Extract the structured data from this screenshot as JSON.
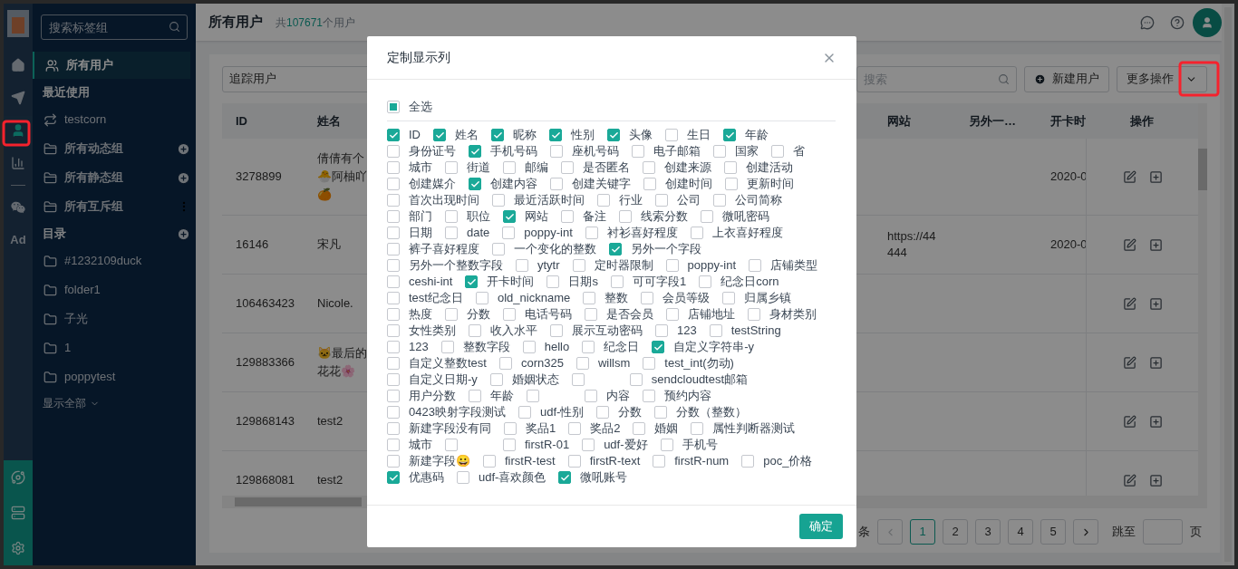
{
  "rail": {
    "nav": [
      {
        "kind": "home",
        "selected": false
      },
      {
        "kind": "send",
        "selected": false
      },
      {
        "kind": "user",
        "selected": true
      },
      {
        "kind": "chart",
        "selected": false
      }
    ],
    "nav_more": [
      {
        "kind": "wechat",
        "selected": false
      },
      {
        "kind": "text",
        "label": "Ad",
        "selected": false
      }
    ],
    "bottom": [
      {
        "kind": "network"
      },
      {
        "kind": "server"
      },
      {
        "kind": "settings"
      }
    ]
  },
  "sidebar": {
    "search_placeholder": "搜索标签组",
    "items": [
      {
        "kind": "all-users",
        "label": "所有用户",
        "selected": true
      },
      {
        "kind": "section",
        "label": "最近使用"
      },
      {
        "kind": "recent",
        "label": "testcorn",
        "selected": false
      },
      {
        "kind": "group",
        "label": "所有动态组",
        "add": true,
        "selected": false
      },
      {
        "kind": "group",
        "label": "所有静态组",
        "add": true,
        "selected": false
      },
      {
        "kind": "group",
        "label": "所有互斥组",
        "more": true,
        "selected": false
      },
      {
        "kind": "section",
        "label": "目录",
        "add": true
      },
      {
        "kind": "folder",
        "label": "#1232109duck",
        "selected": false
      },
      {
        "kind": "folder",
        "label": "folder1",
        "selected": false
      },
      {
        "kind": "folder",
        "label": "子光",
        "selected": false
      },
      {
        "kind": "folder",
        "label": "1",
        "selected": false
      },
      {
        "kind": "folder",
        "label": "poppytest",
        "selected": false
      }
    ],
    "show_all": "显示全部"
  },
  "header": {
    "title": "所有用户",
    "count_prefix": "共",
    "count": "107671",
    "count_suffix": "个用户"
  },
  "toolbar": {
    "segment_select": "追踪用户",
    "search_placeholder": "搜索",
    "new_button": "新建用户",
    "more_button": "更多操作"
  },
  "table": {
    "columns": [
      "ID",
      "姓名",
      "网站",
      "另外一…",
      "开卡时",
      "操作"
    ],
    "rows": [
      {
        "id": "3278899",
        "name": "倩倩有个🐣阿柚吖🍊",
        "card_time": "2020-0"
      },
      {
        "id": "16146",
        "name": "宋凡",
        "website": "https://44444",
        "card_time": "2020-0"
      },
      {
        "id": "106463423",
        "name": "Nicole."
      },
      {
        "id": "129883366",
        "name": "🐱最后的花花🌸"
      },
      {
        "id": "129868143",
        "name": "test2"
      },
      {
        "id": "129868081",
        "name": "test2"
      }
    ]
  },
  "pagination": {
    "total_suffix": "条",
    "pages": [
      {
        "label": "1",
        "selected": true
      },
      {
        "label": "2",
        "selected": false
      },
      {
        "label": "3",
        "selected": false
      },
      {
        "label": "4",
        "selected": false
      },
      {
        "label": "5",
        "selected": false
      }
    ],
    "jump_label": "跳至",
    "page_suffix": "页"
  },
  "dialog": {
    "title": "定制显示列",
    "select_all": {
      "label": "全选",
      "indeterminate": true
    },
    "option_rows": [
      [
        {
          "label": "ID",
          "checked": true
        },
        {
          "label": "姓名",
          "checked": true
        },
        {
          "label": "昵称",
          "checked": true
        },
        {
          "label": "性别",
          "checked": true
        },
        {
          "label": "头像",
          "checked": true
        },
        {
          "label": "生日",
          "checked": false
        },
        {
          "label": "年龄",
          "checked": true
        }
      ],
      [
        {
          "label": "身份证号",
          "checked": false
        },
        {
          "label": "手机号码",
          "checked": true
        },
        {
          "label": "座机号码",
          "checked": false
        },
        {
          "label": "电子邮箱",
          "checked": false
        },
        {
          "label": "国家",
          "checked": false
        },
        {
          "label": "省",
          "checked": false
        }
      ],
      [
        {
          "label": "城市",
          "checked": false
        },
        {
          "label": "街道",
          "checked": false
        },
        {
          "label": "邮编",
          "checked": false
        },
        {
          "label": "是否匿名",
          "checked": false
        },
        {
          "label": "创建来源",
          "checked": false
        },
        {
          "label": "创建活动",
          "checked": false
        }
      ],
      [
        {
          "label": "创建媒介",
          "checked": false
        },
        {
          "label": "创建内容",
          "checked": true
        },
        {
          "label": "创建关键字",
          "checked": false
        },
        {
          "label": "创建时间",
          "checked": false
        },
        {
          "label": "更新时间",
          "checked": false
        }
      ],
      [
        {
          "label": "首次出现时间",
          "checked": false
        },
        {
          "label": "最近活跃时间",
          "checked": false
        },
        {
          "label": "行业",
          "checked": false
        },
        {
          "label": "公司",
          "checked": false
        },
        {
          "label": "公司简称",
          "checked": false
        }
      ],
      [
        {
          "label": "部门",
          "checked": false
        },
        {
          "label": "职位",
          "checked": false
        },
        {
          "label": "网站",
          "checked": true
        },
        {
          "label": "备注",
          "checked": false
        },
        {
          "label": "线索分数",
          "checked": false
        },
        {
          "label": "微吼密码",
          "checked": false
        }
      ],
      [
        {
          "label": "日期",
          "checked": false
        },
        {
          "label": "date",
          "checked": false
        },
        {
          "label": "poppy-int",
          "checked": false
        },
        {
          "label": "衬衫喜好程度",
          "checked": false
        },
        {
          "label": "上衣喜好程度",
          "checked": false
        }
      ],
      [
        {
          "label": "裤子喜好程度",
          "checked": false
        },
        {
          "label": "一个变化的整数",
          "checked": false
        },
        {
          "label": "另外一个字段",
          "checked": true
        }
      ],
      [
        {
          "label": "另外一个整数字段",
          "checked": false
        },
        {
          "label": "ytytr",
          "checked": false
        },
        {
          "label": "定时器限制",
          "checked": false
        },
        {
          "label": "poppy-int",
          "checked": false
        },
        {
          "label": "店铺类型",
          "checked": false
        }
      ],
      [
        {
          "label": "ceshi-int",
          "checked": false
        },
        {
          "label": "开卡时间",
          "checked": true
        },
        {
          "label": "日期s",
          "checked": false
        },
        {
          "label": "可可字段1",
          "checked": false
        },
        {
          "label": "纪念日corn",
          "checked": false
        }
      ],
      [
        {
          "label": "test纪念日",
          "checked": false
        },
        {
          "label": "old_nickname",
          "checked": false
        },
        {
          "label": "整数",
          "checked": false
        },
        {
          "label": "会员等级",
          "checked": false
        },
        {
          "label": "归属乡镇",
          "checked": false
        }
      ],
      [
        {
          "label": "热度",
          "checked": false
        },
        {
          "label": "分数",
          "checked": false
        },
        {
          "label": "电话号码",
          "checked": false
        },
        {
          "label": "是否会员",
          "checked": false
        },
        {
          "label": "店铺地址",
          "checked": false
        },
        {
          "label": "身材类别",
          "checked": false
        }
      ],
      [
        {
          "label": "女性类别",
          "checked": false
        },
        {
          "label": "收入水平",
          "checked": false
        },
        {
          "label": "展示互动密码",
          "checked": false
        },
        {
          "label": "123",
          "checked": false
        },
        {
          "label": "testString",
          "checked": false
        }
      ],
      [
        {
          "label": "123",
          "checked": false
        },
        {
          "label": "整数字段",
          "checked": false
        },
        {
          "label": "hello",
          "checked": false
        },
        {
          "label": "纪念日",
          "checked": false
        },
        {
          "label": "自定义字符串-y",
          "checked": true
        }
      ],
      [
        {
          "label": "自定义整数test",
          "checked": false
        },
        {
          "label": "corn325",
          "checked": false
        },
        {
          "label": "willsm",
          "checked": false
        },
        {
          "label": "test_int(勿动)",
          "checked": false
        }
      ],
      [
        {
          "label": "自定义日期-y",
          "checked": false
        },
        {
          "label": "婚姻状态",
          "checked": false
        },
        {
          "checked": false
        },
        {
          "label": "sendcloudtest邮箱",
          "checked": false
        }
      ],
      [
        {
          "label": "用户分数",
          "checked": false
        },
        {
          "label": "年龄",
          "checked": false
        },
        {
          "checked": false
        },
        {
          "label": "内容",
          "checked": false
        },
        {
          "label": "预约内容",
          "checked": false
        }
      ],
      [
        {
          "label": "0423映射字段测试",
          "checked": false
        },
        {
          "label": "udf-性别",
          "checked": false
        },
        {
          "label": "分数",
          "checked": false
        },
        {
          "label": "分数（整数）",
          "checked": false
        }
      ],
      [
        {
          "label": "新建字段没有同",
          "checked": false
        },
        {
          "label": "奖品1",
          "checked": false
        },
        {
          "label": "奖品2",
          "checked": false
        },
        {
          "label": "婚姻",
          "checked": false
        },
        {
          "label": "属性判断器测试",
          "checked": false
        }
      ],
      [
        {
          "label": "城市",
          "checked": false
        },
        {
          "checked": false
        },
        {
          "label": "firstR-01",
          "checked": false
        },
        {
          "label": "udf-爱好",
          "checked": false
        },
        {
          "label": "手机号",
          "checked": false
        }
      ],
      [
        {
          "label": "新建字段😀",
          "checked": false
        },
        {
          "label": "firstR-test",
          "checked": false
        },
        {
          "label": "firstR-text",
          "checked": false
        },
        {
          "label": "firstR-num",
          "checked": false
        },
        {
          "label": "poc_价格",
          "checked": false
        }
      ],
      [
        {
          "label": "优惠码",
          "checked": true
        },
        {
          "label": "udf-喜欢颜色",
          "checked": false
        },
        {
          "label": "微吼账号",
          "checked": true
        }
      ]
    ],
    "confirm": "确定"
  }
}
